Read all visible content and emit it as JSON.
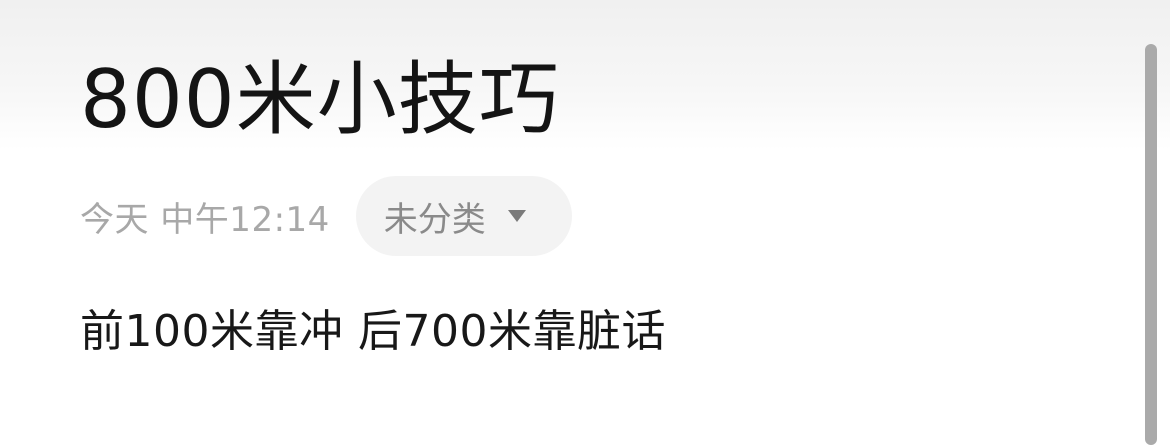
{
  "note": {
    "title": "800米小技巧",
    "timestamp": "今天 中午12:14",
    "category": {
      "selected": "未分类",
      "icon": "chevron-down-icon"
    },
    "body": "前100米靠冲 后700米靠脏话"
  },
  "colors": {
    "title": "#141414",
    "meta": "#a8a8a8",
    "chip_bg": "#f3f3f3",
    "body": "#181818",
    "scrollbar": "#aaaaaa"
  }
}
